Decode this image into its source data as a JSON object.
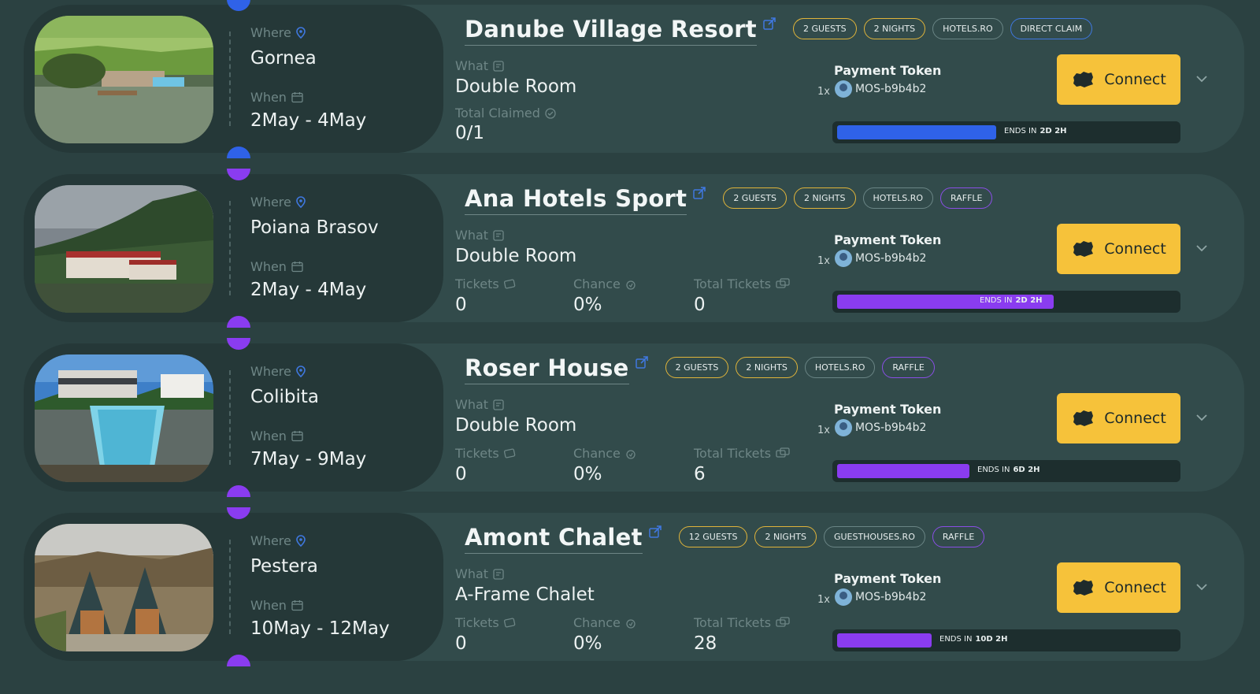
{
  "colors": {
    "blue": "#2f62e8",
    "purple": "#8a3cf0",
    "yellow": "#f6c23a"
  },
  "labels": {
    "where": "Where",
    "when": "When",
    "what": "What",
    "payment_token": "Payment Token",
    "connect": "Connect",
    "ends_in": "ENDS IN",
    "total_claimed": "Total Claimed",
    "tickets": "Tickets",
    "chance": "Chance",
    "total_tickets": "Total Tickets"
  },
  "listings": [
    {
      "name": "Danube Village Resort",
      "where": "Gornea",
      "when": "2May - 4May",
      "what": "Double Room",
      "tags": [
        "2 GUESTS",
        "2 NIGHTS",
        "HOTELS.RO",
        "DIRECT CLAIM"
      ],
      "stats": {
        "total_claimed": "0/1"
      },
      "payment": {
        "multiplier": "1x",
        "token": "MOS-b9b4b2"
      },
      "ends_in": "2D 2H",
      "progress": 0.47,
      "accent": "blue"
    },
    {
      "name": "Ana Hotels Sport",
      "where": "Poiana Brasov",
      "when": "2May - 4May",
      "what": "Double Room",
      "tags": [
        "2 GUESTS",
        "2 NIGHTS",
        "HOTELS.RO",
        "RAFFLE"
      ],
      "stats": {
        "tickets": "0",
        "chance": "0%",
        "total_tickets": "0"
      },
      "payment": {
        "multiplier": "1x",
        "token": "MOS-b9b4b2"
      },
      "ends_in": "2D 2H",
      "progress": 0.64,
      "accent": "purple"
    },
    {
      "name": "Roser House",
      "where": "Colibita",
      "when": "7May - 9May",
      "what": "Double Room",
      "tags": [
        "2 GUESTS",
        "2 NIGHTS",
        "HOTELS.RO",
        "RAFFLE"
      ],
      "stats": {
        "tickets": "0",
        "chance": "0%",
        "total_tickets": "6"
      },
      "payment": {
        "multiplier": "1x",
        "token": "MOS-b9b4b2"
      },
      "ends_in": "6D 2H",
      "progress": 0.39,
      "accent": "purple"
    },
    {
      "name": "Amont Chalet",
      "where": "Pestera",
      "when": "10May - 12May",
      "what": "A-Frame Chalet",
      "tags": [
        "12 GUESTS",
        "2 NIGHTS",
        "GUESTHOUSES.RO",
        "RAFFLE"
      ],
      "stats": {
        "tickets": "0",
        "chance": "0%",
        "total_tickets": "28"
      },
      "payment": {
        "multiplier": "1x",
        "token": "MOS-b9b4b2"
      },
      "ends_in": "10D 2H",
      "progress": 0.28,
      "accent": "purple"
    }
  ]
}
